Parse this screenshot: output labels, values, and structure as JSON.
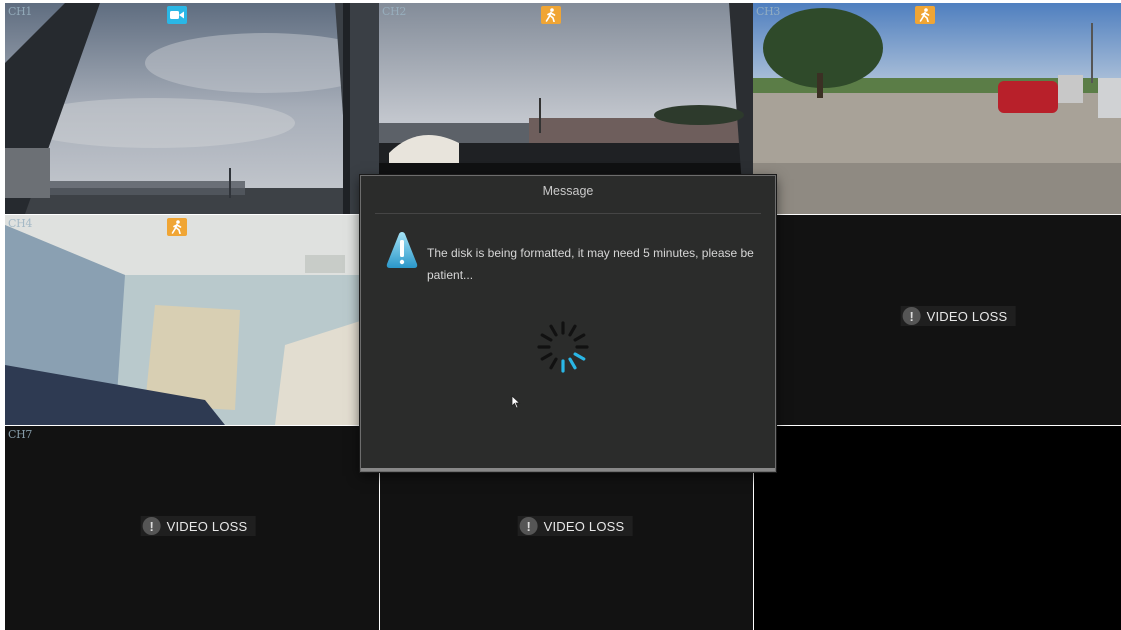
{
  "channels": [
    {
      "label": "CH1",
      "status": "recording-icon",
      "state": "live"
    },
    {
      "label": "CH2",
      "status": "motion-icon",
      "state": "live"
    },
    {
      "label": "CH3",
      "status": "motion-icon",
      "state": "live"
    },
    {
      "label": "CH4",
      "status": "motion-icon",
      "state": "live"
    },
    {
      "label": "",
      "status": "",
      "state": "covered"
    },
    {
      "label": "",
      "status": "",
      "state": "video-loss",
      "loss_text": "VIDEO LOSS"
    },
    {
      "label": "CH7",
      "status": "",
      "state": "video-loss",
      "loss_text": "VIDEO LOSS"
    },
    {
      "label": "",
      "status": "",
      "state": "video-loss",
      "loss_text": "VIDEO LOSS"
    },
    {
      "label": "",
      "status": "",
      "state": "empty"
    }
  ],
  "dialog": {
    "title": "Message",
    "message": "The disk is being formatted, it may need 5 minutes, please be patient...",
    "icon": "info-icon",
    "progress_indicator": "loading-spinner-icon"
  },
  "colors": {
    "selection_border": "#2ab7e6",
    "recording_badge": "#2ab7e6",
    "motion_badge": "#f0a534",
    "dialog_bg": "#2b2c2b",
    "spinner_active": "#2ab7e6",
    "spinner_idle": "#111111"
  }
}
